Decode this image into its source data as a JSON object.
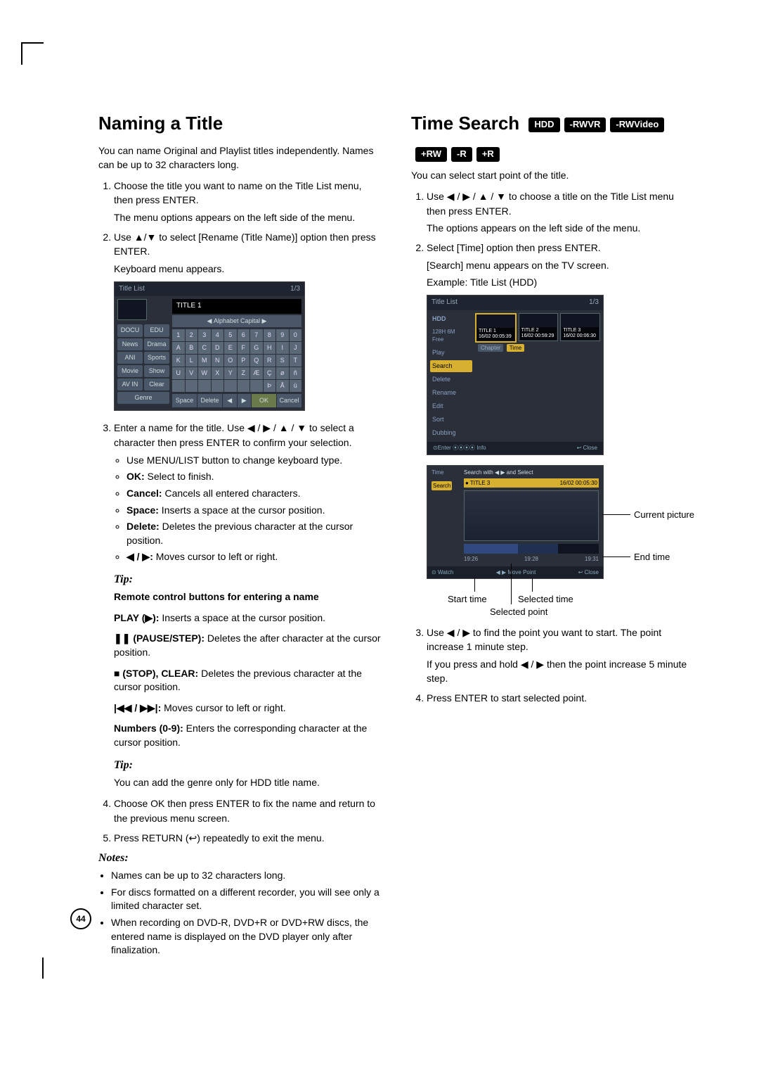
{
  "left": {
    "title": "Naming a Title",
    "intro": "You can name Original and Playlist titles independently. Names can be up to 32 characters long.",
    "step1a": "Choose the title you want to name on the Title List menu, then press ENTER.",
    "step1b": "The menu options appears on the left side of the menu.",
    "step2a": "Use ▲/▼ to select [Rename (Title Name)] option then press ENTER.",
    "step2b": "Keyboard menu appears.",
    "kb": {
      "header": "Title List",
      "page": "1/3",
      "title_field": "TITLE 1",
      "mode": "Alphabet Capital",
      "genres": [
        "DOCU",
        "EDU",
        "News",
        "Drama",
        "ANI",
        "Sports",
        "Movie",
        "Show",
        "AV IN",
        "Clear",
        "Genre"
      ],
      "rows": [
        [
          "1",
          "2",
          "3",
          "4",
          "5",
          "6",
          "7",
          "8",
          "9",
          "0"
        ],
        [
          "A",
          "B",
          "C",
          "D",
          "E",
          "F",
          "G",
          "H",
          "I",
          "J"
        ],
        [
          "K",
          "L",
          "M",
          "N",
          "O",
          "P",
          "Q",
          "R",
          "S",
          "T"
        ],
        [
          "U",
          "V",
          "W",
          "X",
          "Y",
          "Z",
          "Æ",
          "Ç",
          "ø",
          "ñ"
        ],
        [
          "",
          "",
          "",
          "",
          "",
          "",
          "",
          "Þ",
          "Å",
          "ü"
        ]
      ],
      "actions": [
        "Space",
        "Delete",
        "◀",
        "▶",
        "OK",
        "Cancel"
      ]
    },
    "step3": "Enter a name for the title. Use ◀ / ▶ / ▲ / ▼ to select a character then press ENTER to confirm your selection.",
    "b1": "Use MENU/LIST button to change keyboard type.",
    "b2_label": "OK:",
    "b2_text": " Select to finish.",
    "b3_label": "Cancel:",
    "b3_text": " Cancels all entered characters.",
    "b4_label": "Space:",
    "b4_text": " Inserts a space at the cursor position.",
    "b5_label": "Delete:",
    "b5_text": " Deletes the previous character at the cursor position.",
    "b6_label": "◀ / ▶:",
    "b6_text": " Moves cursor to left or right.",
    "tip1_label": "Tip:",
    "tip1_bold": "Remote control buttons for entering a name",
    "play_label": "PLAY (▶):",
    "play_text": " Inserts a space at the cursor position.",
    "pause_label": "❚❚ (PAUSE/STEP):",
    "pause_text": " Deletes the after character at the cursor position.",
    "stop_label": "■ (STOP), CLEAR:",
    "stop_text": " Deletes the previous character at the cursor position.",
    "skip_label": "|◀◀ / ▶▶|:",
    "skip_text": " Moves cursor to left or right.",
    "num_label": "Numbers (0-9):",
    "num_text": " Enters the corresponding character at the cursor position.",
    "tip2_label": "Tip:",
    "tip2_text": "You can add the genre only for HDD title name.",
    "step4": "Choose OK then press ENTER to fix the name and return to the previous menu screen.",
    "step5": "Press RETURN (↩) repeatedly to exit the menu.",
    "notes_label": "Notes:",
    "n1": "Names can be up to 32 characters long.",
    "n2": "For discs formatted on a different recorder, you will see only a limited character set.",
    "n3": "When recording on DVD-R, DVD+R or DVD+RW discs, the entered name is displayed on the DVD player only after finalization."
  },
  "right": {
    "title": "Time Search",
    "badges1": [
      "HDD",
      "-RWVR",
      "-RWVideo"
    ],
    "badges2": [
      "+RW",
      "-R",
      "+R"
    ],
    "intro": "You can select start point of the title.",
    "step1a": "Use ◀ / ▶ / ▲ / ▼ to choose a title on the Title List menu then press ENTER.",
    "step1b": "The options appears on the left side of the menu.",
    "step2a": "Select [Time] option then press ENTER.",
    "step2b": "[Search] menu appears on the TV screen.",
    "step2c": "Example: Title List (HDD)",
    "tl": {
      "header": "Title List",
      "page": "1/3",
      "side_top1": "HDD",
      "side_top2": "128H 6M",
      "side_top3": "Free",
      "side_items": [
        "Play",
        "Search",
        "Delete",
        "Rename",
        "Edit",
        "Sort",
        "Dubbing"
      ],
      "sub_items": [
        "Chapter",
        "Time"
      ],
      "thumbs": [
        {
          "t": "TITLE 1",
          "d": "16/02  00:05:39"
        },
        {
          "t": "TITLE 2",
          "d": "16/02  00:59:29"
        },
        {
          "t": "TITLE 3",
          "d": "16/02  00:06:30"
        }
      ],
      "foot_left": "⊙Enter     ⦿⦿⦿⦿ Info",
      "foot_right": "↩ Close"
    },
    "tss": {
      "side_time": "Time",
      "side_search": "Search",
      "hint": "Search with ◀ ▶ and Select",
      "title": "TITLE 3",
      "date": "16/02   00:05:30",
      "t_left": "19:26",
      "t_mid": "19:28",
      "t_right": "19:31",
      "foot_left": "⊙ Watch",
      "foot_mid": "◀ ▶ Move Point",
      "foot_right": "↩ Close"
    },
    "ann_current": "Current picture",
    "ann_end": "End time",
    "ann_start": "Start time",
    "ann_selected_time": "Selected time",
    "ann_selected_point": "Selected point",
    "step3a": "Use ◀ / ▶ to find the point you want to start. The point increase 1 minute step.",
    "step3b": "If you press and hold ◀ / ▶ then the point increase 5 minute step.",
    "step4": "Press ENTER to start selected point."
  },
  "page_number": "44"
}
